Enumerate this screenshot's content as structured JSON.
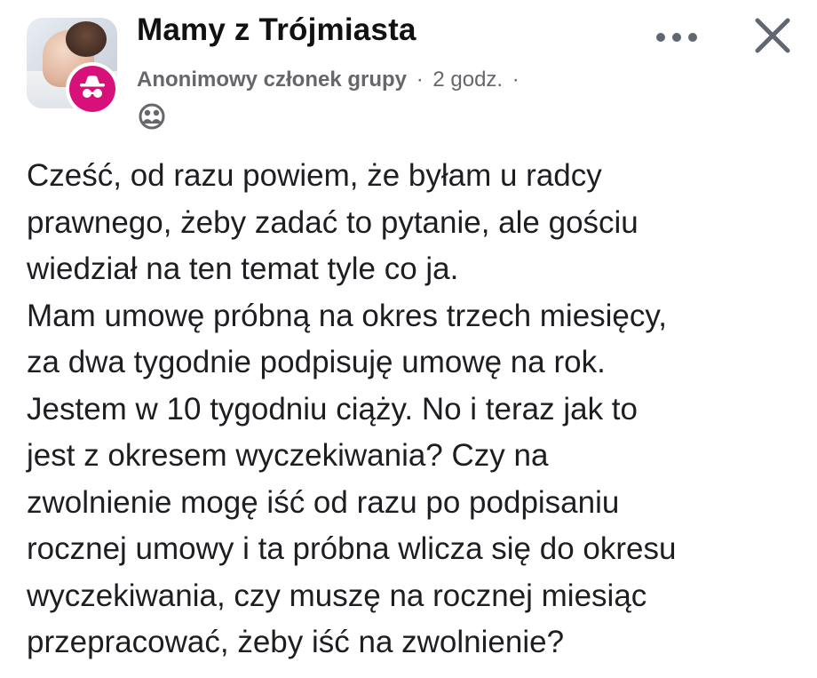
{
  "header": {
    "group_name": "Mamy z Trójmiasta",
    "author": "Anonimowy członek grupy",
    "separator": "·",
    "time": "2 godz.",
    "trailing_separator": "·",
    "privacy_icon": "group-members-icon",
    "more_icon": "more-options-icon",
    "close_icon": "close-icon",
    "avatar_badge_icon": "anonymous-icon"
  },
  "colors": {
    "badge": "#d8117a",
    "meta_text": "#65676b",
    "body_text": "#1c1e21"
  },
  "post": {
    "lines": [
      "Cześć, od razu powiem, że byłam u radcy",
      "prawnego, żeby zadać to pytanie, ale gościu",
      "wiedział na ten temat tyle co ja.",
      "Mam umowę próbną na okres trzech miesięcy,",
      "za dwa tygodnie podpisuję umowę na rok.",
      "Jestem w 10 tygodniu ciąży. No i teraz jak to",
      "jest z okresem wyczekiwania? Czy na",
      "zwolnienie mogę iść od razu po podpisaniu",
      "rocznej umowy i ta próbna wlicza się do okresu",
      "wyczekiwania, czy muszę na rocznej miesiąc",
      "przepracować, żeby iść na zwolnienie?"
    ]
  }
}
